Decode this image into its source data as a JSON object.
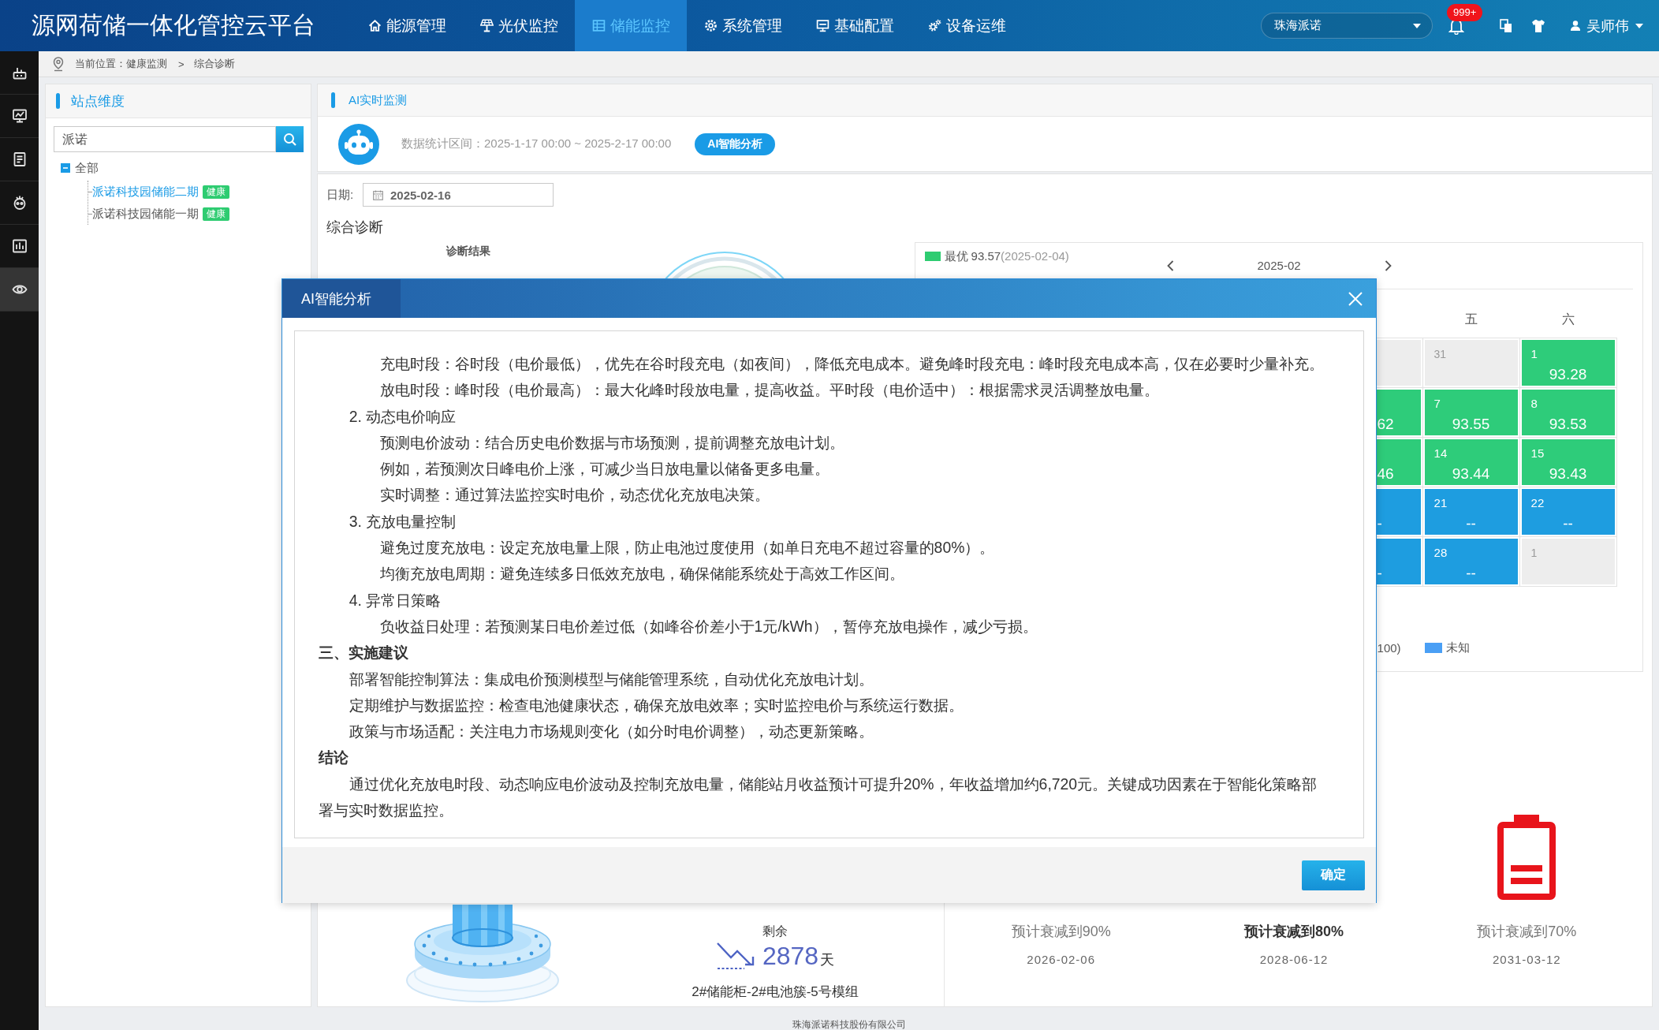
{
  "header": {
    "title": "源网荷储一体化管控云平台",
    "nav": [
      {
        "label": "能源管理",
        "selected": false
      },
      {
        "label": "光伏监控",
        "selected": false
      },
      {
        "label": "储能监控",
        "selected": true
      },
      {
        "label": "系统管理",
        "selected": false
      },
      {
        "label": "基础配置",
        "selected": false
      },
      {
        "label": "设备运维",
        "selected": false
      }
    ],
    "org_select": {
      "value": "珠海派诺"
    },
    "notifications": {
      "badge": "999+"
    },
    "user": {
      "name": "吴师伟"
    }
  },
  "sidebar": {
    "items": [
      {
        "selected": false
      },
      {
        "selected": false
      },
      {
        "selected": false
      },
      {
        "selected": false
      },
      {
        "selected": false
      },
      {
        "selected": true
      }
    ]
  },
  "breadcrumb": {
    "path": "当前位置：健康监测",
    "separator": ">",
    "current": "综合诊断"
  },
  "site_panel": {
    "title": "站点维度",
    "search": {
      "value": "派诺"
    },
    "tree": {
      "label": "全部",
      "expanded": true,
      "children": [
        {
          "label": "派诺科技园储能二期",
          "badge": "健康",
          "selected": true
        },
        {
          "label": "派诺科技园储能一期",
          "badge": "健康",
          "selected": false
        }
      ]
    }
  },
  "monitor": {
    "title": "AI实时监测",
    "range": "数据统计区间：2025-1-17 00:00 ~ 2025-2-17 00:00",
    "analyze_button": "AI智能分析"
  },
  "diagnosis": {
    "date_label": "日期:",
    "date": "2025-02-16",
    "title": "综合诊断",
    "result_label": "诊断结果",
    "calendar": {
      "best": {
        "label": "最优",
        "value": "93.57",
        "date": "(2025-02-04)",
        "color": "#2ecc71"
      },
      "month": "2025-02",
      "weekdays": [
        "五",
        "六"
      ],
      "weeks": [
        {
          "cells": [
            {
              "in_month": false
            },
            {
              "in_month": false,
              "day": "31"
            },
            {
              "in_month": true,
              "color": "#2ecc7a",
              "day": "1",
              "value": "93.28"
            }
          ]
        },
        {
          "cells": [
            {
              "in_month": true,
              "color": "#2ecc7a",
              "value": "62"
            },
            {
              "in_month": true,
              "color": "#2ecc7a",
              "day": "7",
              "value": "93.55"
            },
            {
              "in_month": true,
              "color": "#2ecc7a",
              "day": "8",
              "value": "93.53"
            }
          ]
        },
        {
          "cells": [
            {
              "in_month": true,
              "color": "#2ecc7a",
              "value": "46"
            },
            {
              "in_month": true,
              "color": "#2ecc7a",
              "day": "14",
              "value": "93.44"
            },
            {
              "in_month": true,
              "color": "#2ecc7a",
              "day": "15",
              "value": "93.43"
            }
          ]
        },
        {
          "cells": [
            {
              "in_month": true,
              "color": "#1e9de0",
              "value": "-"
            },
            {
              "in_month": true,
              "color": "#1e9de0",
              "day": "21",
              "value": "--"
            },
            {
              "in_month": true,
              "color": "#1e9de0",
              "day": "22",
              "value": "--"
            }
          ]
        },
        {
          "cells": [
            {
              "in_month": true,
              "color": "#1e9de0",
              "value": "-"
            },
            {
              "in_month": true,
              "color": "#1e9de0",
              "day": "28",
              "value": "--"
            },
            {
              "in_month": false,
              "day": "1"
            }
          ]
        }
      ],
      "legend": [
        {
          "label": "100)"
        },
        {
          "label": "未知",
          "color": "#4a9ff5"
        }
      ]
    },
    "lifetime": {
      "remaining_label": "剩余",
      "days": "2878",
      "unit": "天",
      "module": "2#储能柜-2#电池簇-5号模组",
      "forecasts": [
        {
          "title": "预计衰减到90%",
          "date": "2026-02-06",
          "highlighted": false
        },
        {
          "title": "预计衰减到80%",
          "date": "2028-06-12",
          "highlighted": true
        },
        {
          "title": "预计衰减到70%",
          "date": "2031-03-12",
          "highlighted": false,
          "color": "#e8141b"
        }
      ]
    }
  },
  "dialog": {
    "title": "AI智能分析",
    "content": [
      {
        "children": [
          {
            "children": [
              {
                "text": "充电时段：谷时段（电价最低），优先在谷时段充电（如夜间），降低充电成本。避免峰时段充电：峰时段充电成本高，仅在必要时少量补充。"
              },
              {
                "text": "放电时段：峰时段（电价最高）：最大化峰时段放电量，提高收益。平时段（电价适中）：根据需求灵活调整放电量。"
              }
            ]
          },
          {
            "text": "2. 动态电价响应",
            "children": [
              {
                "text": "预测电价波动：结合历史电价数据与市场预测，提前调整充放电计划。"
              },
              {
                "text": "例如，若预测次日峰电价上涨，可减少当日放电量以储备更多电量。"
              },
              {
                "text": "实时调整：通过算法监控实时电价，动态优化充放电决策。"
              }
            ]
          },
          {
            "text": "3. 充放电量控制",
            "children": [
              {
                "text": "避免过度充放电：设定充放电量上限，防止电池过度使用（如单日充电不超过容量的80%）。"
              },
              {
                "text": "均衡充放电周期：避免连续多日低效充放电，确保储能系统处于高效工作区间。"
              }
            ]
          },
          {
            "text": "4. 异常日策略",
            "children": [
              {
                "text": "负收益日处理：若预测某日电价差过低（如峰谷价差小于1元/kWh），暂停充放电操作，减少亏损。"
              }
            ]
          }
        ]
      },
      {
        "text": "三、实施建议",
        "children": [
          {
            "text": "部署智能控制算法：集成电价预测模型与储能管理系统，自动优化充放电计划。"
          },
          {
            "text": "定期维护与数据监控：检查电池健康状态，确保充放电效率；实时监控电价与系统运行数据。"
          },
          {
            "text": "政策与市场适配：关注电力市场规则变化（如分时电价调整），动态更新策略。"
          }
        ]
      },
      {
        "text": "结论",
        "children": [
          {
            "text": "通过优化充放电时段、动态响应电价波动及控制充放电量，储能站月收益预计可提升20%，年收益增加约6,720元。关键成功因素在于智能化策略部署与实时数据监控。"
          }
        ]
      }
    ],
    "confirm": "确定"
  },
  "footer": {
    "company": "珠海派诺科技股份有限公司"
  }
}
